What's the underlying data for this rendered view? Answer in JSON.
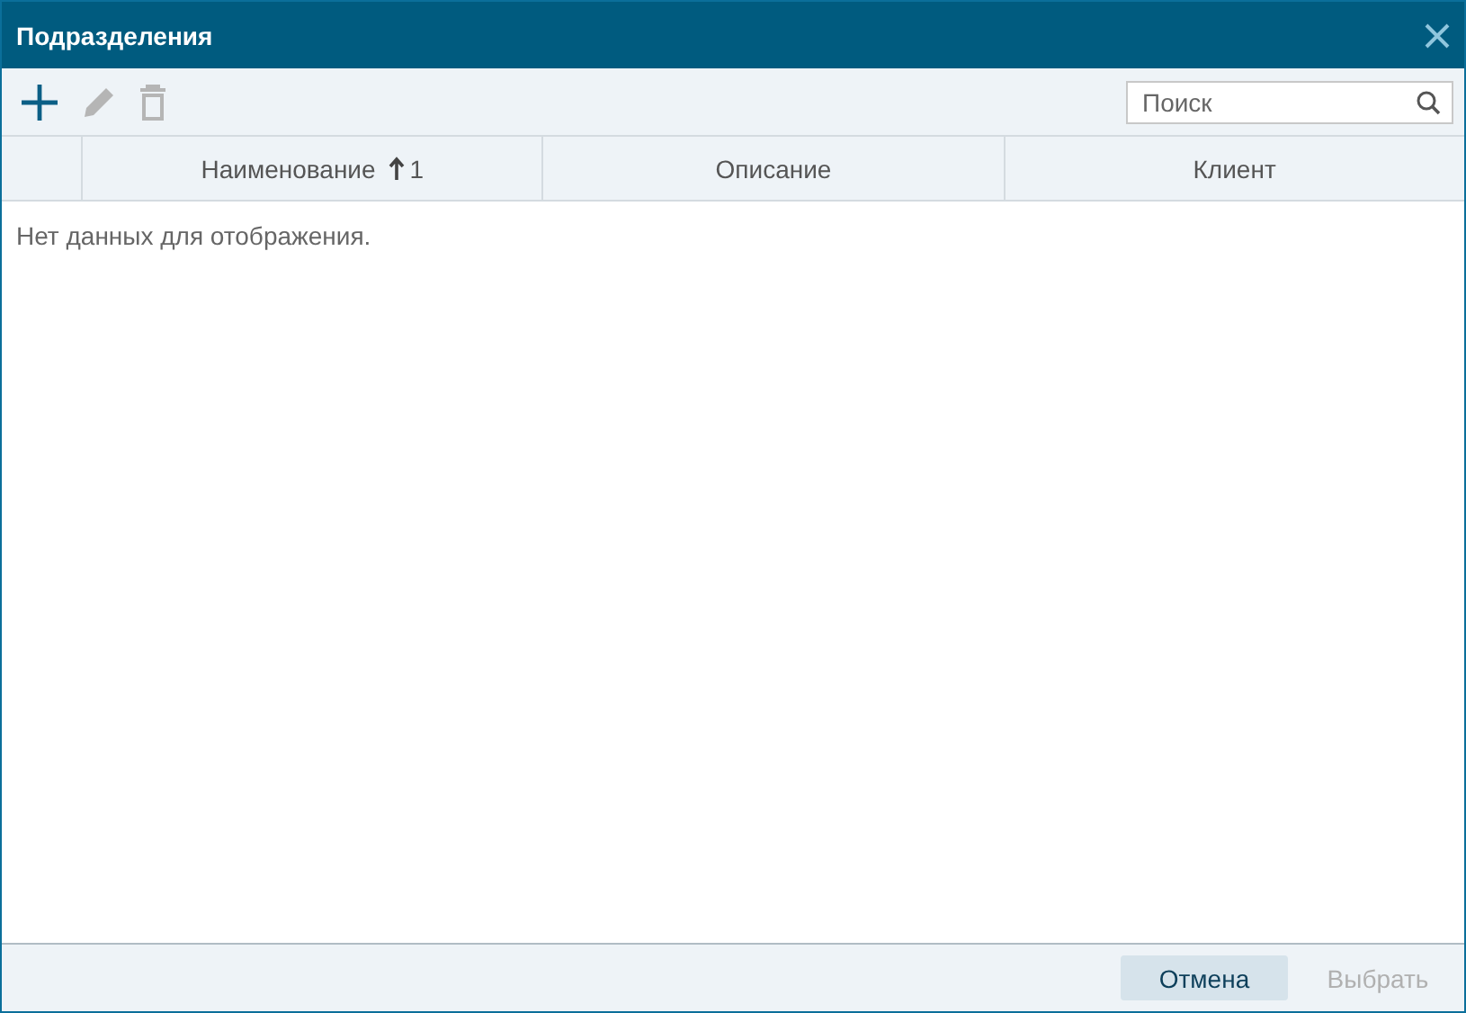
{
  "window": {
    "title": "Подразделения"
  },
  "toolbar": {
    "buttons": [
      {
        "kind": "add",
        "disabled": false
      },
      {
        "kind": "edit",
        "disabled": true
      },
      {
        "kind": "delete",
        "disabled": true
      }
    ],
    "search": {
      "placeholder": "Поиск"
    }
  },
  "table": {
    "columns": [
      {
        "label": "Наименование",
        "sort_rank": "1"
      },
      {
        "label": "Описание"
      },
      {
        "label": "Клиент"
      }
    ],
    "empty_message": "Нет данных для отображения."
  },
  "footer": {
    "buttons": [
      {
        "label": "Отмена",
        "disabled": false
      },
      {
        "label": "Выбрать",
        "disabled": true
      }
    ]
  }
}
